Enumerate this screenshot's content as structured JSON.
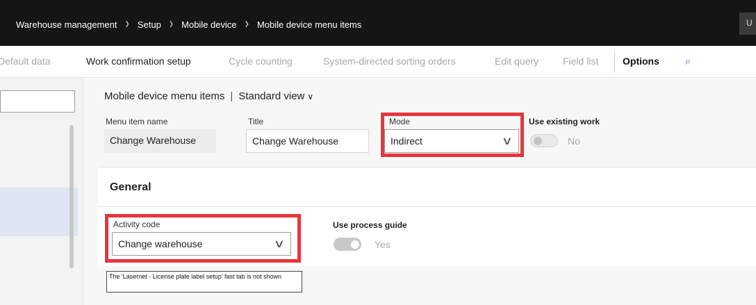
{
  "nav": {
    "breadcrumbs": [
      "Warehouse management",
      "Setup",
      "Mobile device",
      "Mobile device menu items"
    ],
    "user_initial": "U"
  },
  "action_pane": {
    "items": [
      {
        "label": "Default data"
      },
      {
        "label": "Work confirmation setup"
      },
      {
        "label": "Cycle counting"
      },
      {
        "label": "System-directed sorting orders"
      },
      {
        "label": "Edit query"
      },
      {
        "label": "Field list"
      },
      {
        "label": "Options"
      }
    ],
    "search_icon": "search-icon"
  },
  "view": {
    "title": "Mobile device menu items",
    "separator": "|",
    "view_name": "Standard view"
  },
  "header_fields": {
    "menu_item_name_label": "Menu item name",
    "menu_item_name_value": "Change Warehouse",
    "title_label": "Title",
    "title_value": "Change Warehouse",
    "mode_label": "Mode",
    "mode_value": "Indirect",
    "use_existing_work_label": "Use existing work",
    "use_existing_work_value": "No"
  },
  "general": {
    "title": "General",
    "activity_code_label": "Activity code",
    "activity_code_value": "Change warehouse",
    "use_process_guide_label": "Use process guide",
    "use_process_guide_value": "Yes"
  },
  "annotation": {
    "text": "The 'Lasernet - License plate label setup' fast tab is not shown"
  },
  "colors": {
    "highlight": "#e8353b",
    "nav_bg": "#151515",
    "accent": "#3a66c4"
  }
}
